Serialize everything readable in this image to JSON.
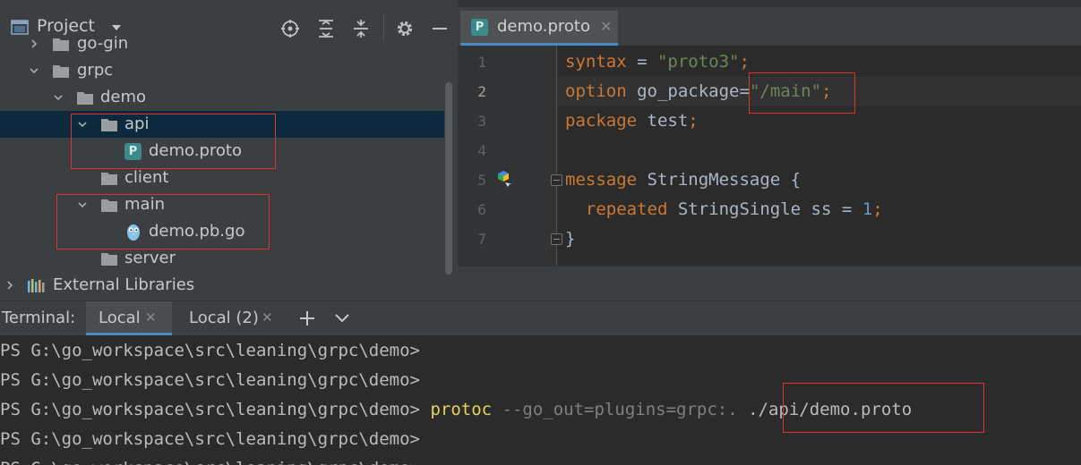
{
  "project_panel": {
    "title": "Project",
    "tree": [
      {
        "label": "go-gin",
        "depth": 1,
        "kind": "folder",
        "expanded": false
      },
      {
        "label": "grpc",
        "depth": 1,
        "kind": "folder",
        "expanded": true
      },
      {
        "label": "demo",
        "depth": 2,
        "kind": "folder",
        "expanded": true
      },
      {
        "label": "api",
        "depth": 3,
        "kind": "folder",
        "expanded": true,
        "selected": true
      },
      {
        "label": "demo.proto",
        "depth": 4,
        "kind": "proto-file"
      },
      {
        "label": "client",
        "depth": 3,
        "kind": "folder"
      },
      {
        "label": "main",
        "depth": 3,
        "kind": "folder",
        "expanded": true
      },
      {
        "label": "demo.pb.go",
        "depth": 4,
        "kind": "go-file"
      },
      {
        "label": "server",
        "depth": 3,
        "kind": "folder"
      },
      {
        "label": "External Libraries",
        "depth": 0,
        "kind": "libraries",
        "expanded": false
      }
    ]
  },
  "editor": {
    "tab": {
      "label": "demo.proto",
      "icon_letter": "P"
    },
    "current_line": 2,
    "lines": [
      {
        "num": "1",
        "tokens": [
          {
            "t": "syntax",
            "c": "kw"
          },
          {
            "t": " = ",
            "c": "plain"
          },
          {
            "t": "\"proto3\"",
            "c": "str"
          },
          {
            "t": ";",
            "c": "kw"
          }
        ]
      },
      {
        "num": "2",
        "tokens": [
          {
            "t": "option",
            "c": "kw"
          },
          {
            "t": " go_package",
            "c": "plain"
          },
          {
            "t": "=",
            "c": "plain"
          },
          {
            "t": "\"/main\"",
            "c": "str"
          },
          {
            "t": ";",
            "c": "kw"
          }
        ]
      },
      {
        "num": "3",
        "tokens": [
          {
            "t": "package",
            "c": "kw"
          },
          {
            "t": " test",
            "c": "plain"
          },
          {
            "t": ";",
            "c": "kw"
          }
        ]
      },
      {
        "num": "4",
        "tokens": []
      },
      {
        "num": "5",
        "tokens": [
          {
            "t": "message",
            "c": "kw"
          },
          {
            "t": " StringMessage {",
            "c": "plain"
          }
        ]
      },
      {
        "num": "6",
        "tokens": [
          {
            "t": "  repeated",
            "c": "kw"
          },
          {
            "t": " StringSingle ss = ",
            "c": "plain"
          },
          {
            "t": "1",
            "c": "num"
          },
          {
            "t": ";",
            "c": "kw"
          }
        ]
      },
      {
        "num": "7",
        "tokens": [
          {
            "t": "}",
            "c": "plain"
          }
        ]
      }
    ]
  },
  "terminal": {
    "label": "Terminal:",
    "tabs": [
      {
        "label": "Local",
        "active": true
      },
      {
        "label": "Local (2)",
        "active": false
      }
    ],
    "lines": [
      {
        "prompt": "PS G:\\go_workspace\\src\\leaning\\grpc\\demo>",
        "cmd": "",
        "opt": "",
        "arg": ""
      },
      {
        "prompt": "PS G:\\go_workspace\\src\\leaning\\grpc\\demo>",
        "cmd": "",
        "opt": "",
        "arg": ""
      },
      {
        "prompt": "PS G:\\go_workspace\\src\\leaning\\grpc\\demo>",
        "cmd": "protoc",
        "opt": "--go_out=plugins=grpc:.",
        "arg": "./api/demo.proto"
      },
      {
        "prompt": "PS G:\\go_workspace\\src\\leaning\\grpc\\demo>",
        "cmd": "",
        "opt": "",
        "arg": ""
      },
      {
        "prompt": "PS G:\\go_workspace\\src\\leaning\\grpc\\demo>",
        "cmd": "",
        "opt": "",
        "arg": ""
      }
    ]
  },
  "colors": {
    "accent": "#4a88c7",
    "highlight": "#e2332a",
    "selection": "#0d293e"
  }
}
